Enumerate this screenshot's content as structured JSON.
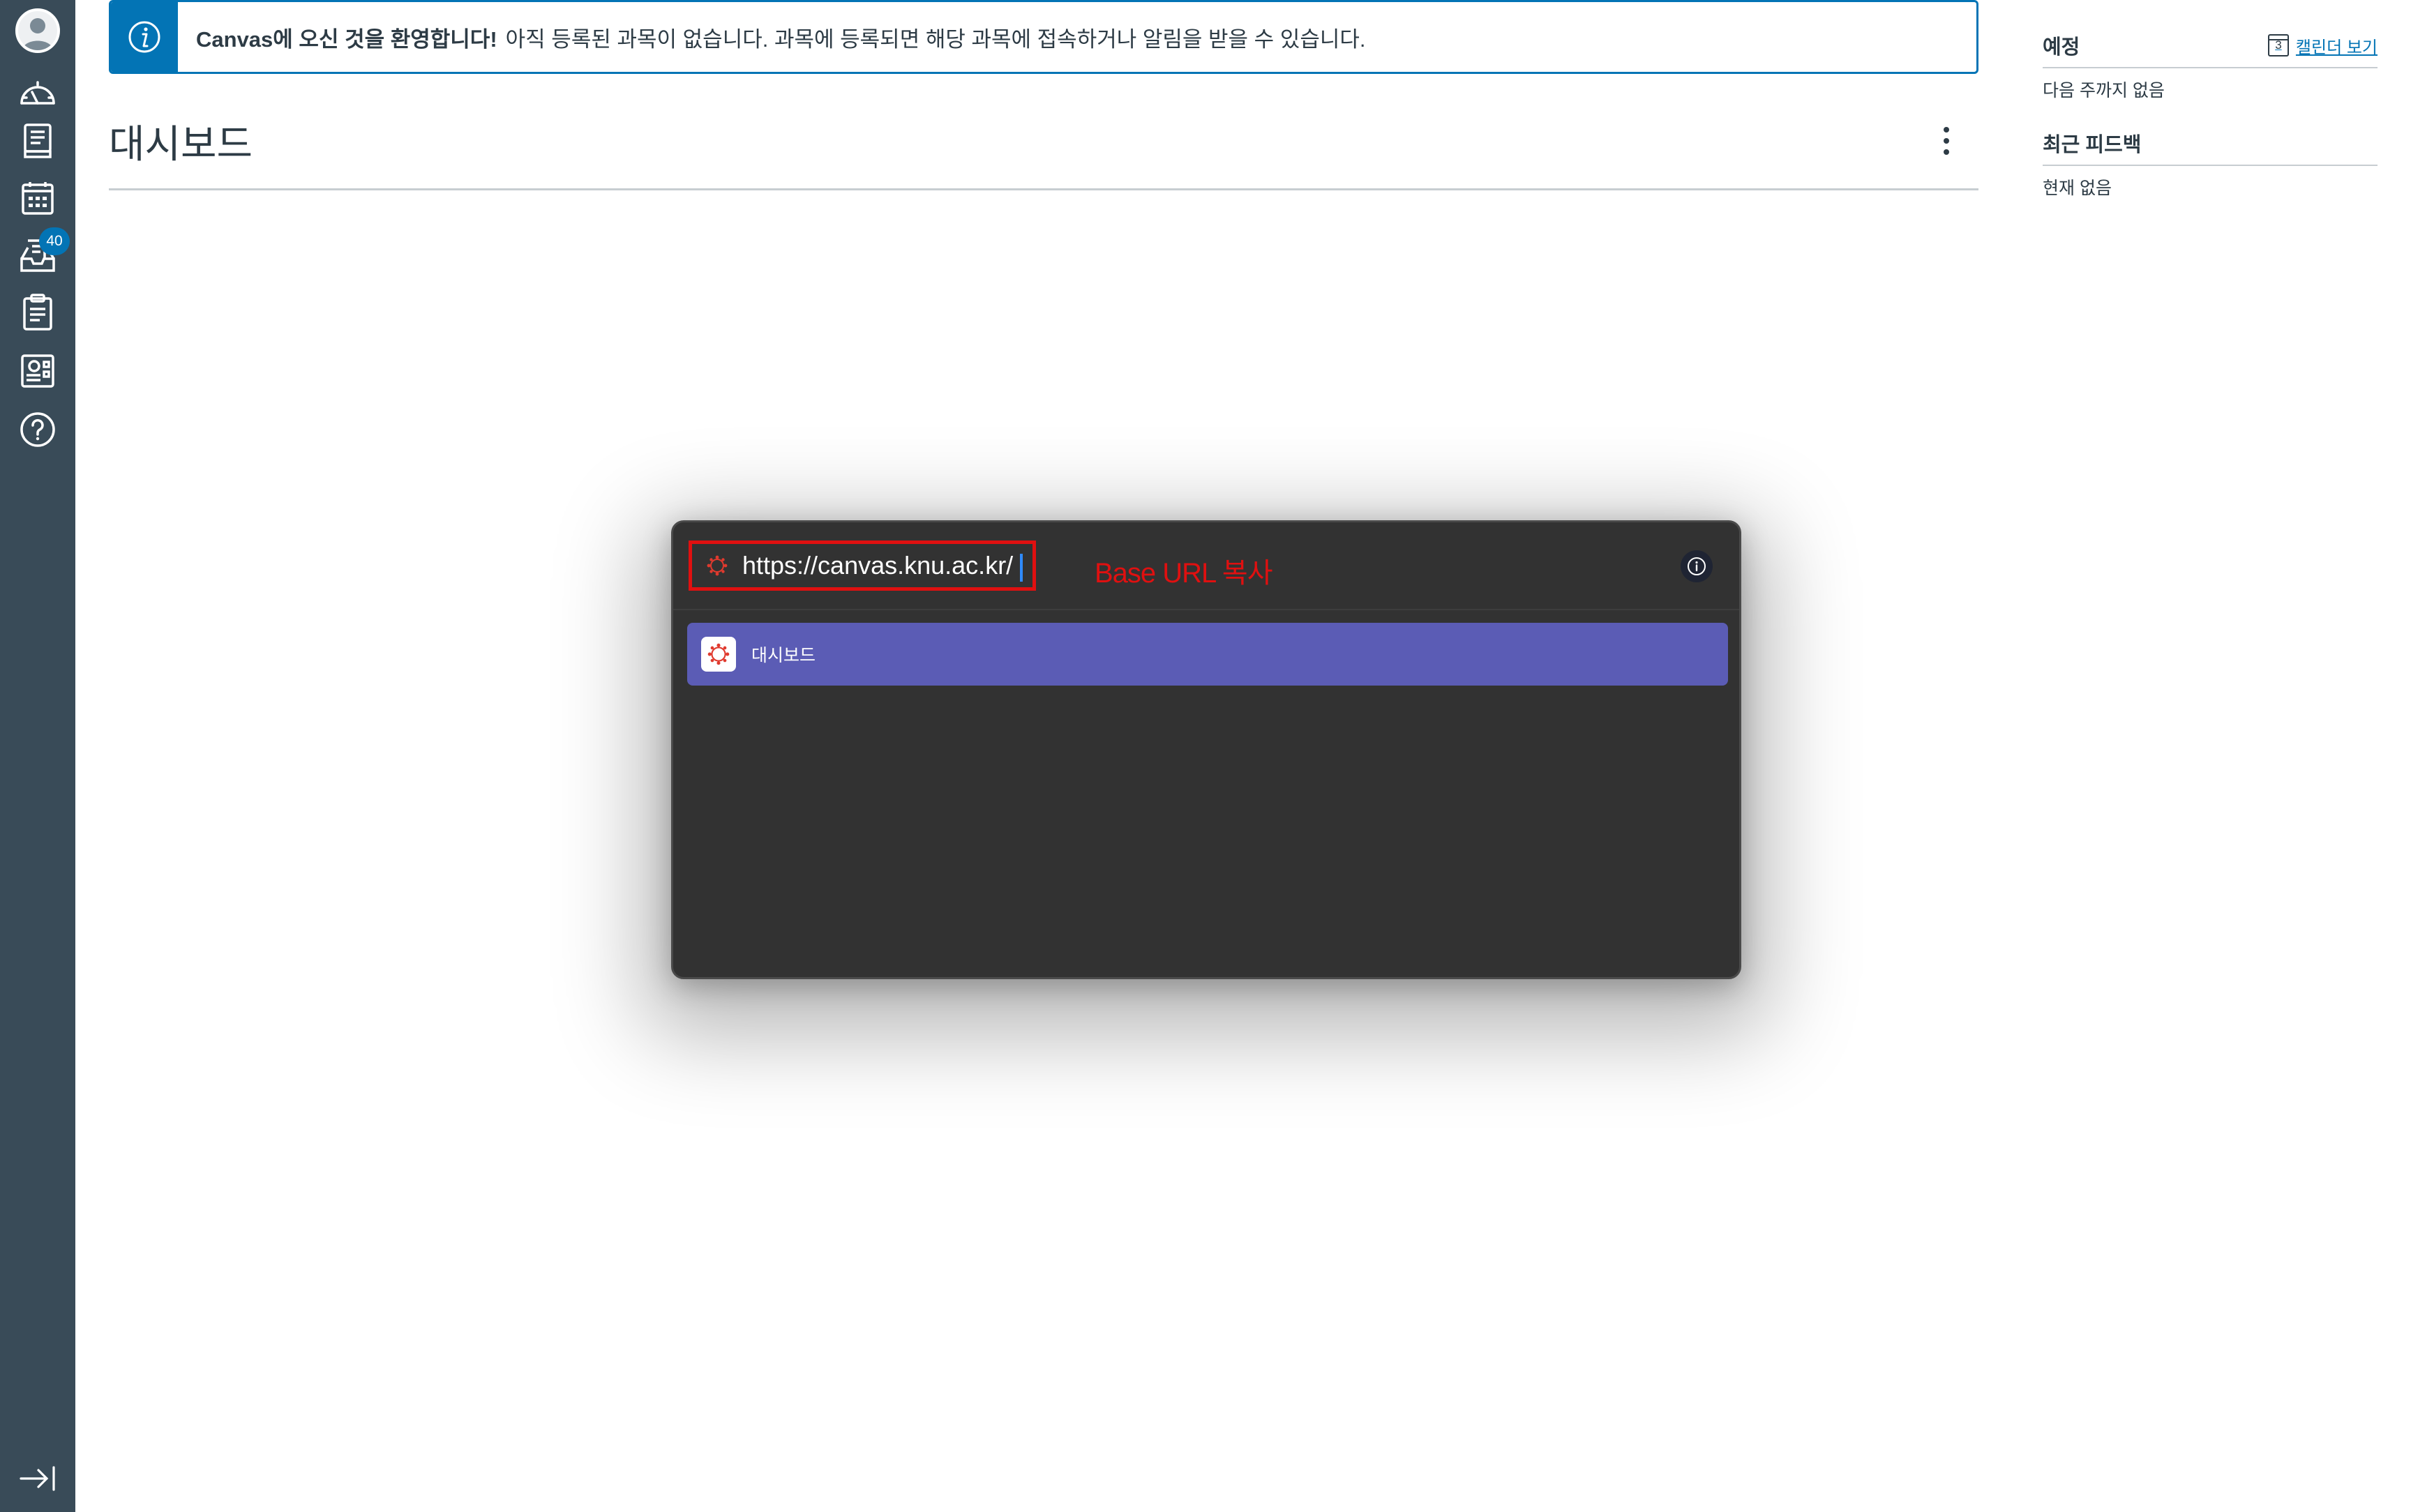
{
  "nav": {
    "items": [
      {
        "name": "account",
        "icon": "user-avatar-icon"
      },
      {
        "name": "dashboard",
        "icon": "dashboard-icon"
      },
      {
        "name": "courses",
        "icon": "courses-icon"
      },
      {
        "name": "calendar",
        "icon": "calendar-icon"
      },
      {
        "name": "inbox",
        "icon": "inbox-icon",
        "badge": "40"
      },
      {
        "name": "assignments",
        "icon": "clipboard-icon"
      },
      {
        "name": "portfolio",
        "icon": "portfolio-icon"
      },
      {
        "name": "help",
        "icon": "help-icon"
      },
      {
        "name": "collapse",
        "icon": "collapse-nav-icon"
      }
    ],
    "inbox_badge": "40"
  },
  "banner": {
    "bold": "Canvas에 오신 것을 환영합니다!",
    "text": "아직 등록된 과목이 없습니다. 과목에 등록되면 해당 과목에 접속하거나 알림을 받을 수 있습니다.",
    "icon": "info-icon",
    "accent": "#0374b5"
  },
  "page": {
    "title": "대시보드"
  },
  "sidebar": {
    "upcoming": {
      "heading": "예정",
      "calendar_link": "캘린더 보기",
      "calendar_day": "3",
      "empty": "다음 주까지 없음"
    },
    "feedback": {
      "heading": "최근 피드백",
      "empty": "현재 없음"
    }
  },
  "launcher": {
    "input_value": "https://canvas.knu.ac.kr/",
    "annotation": "Base URL 복사",
    "results": [
      {
        "label": "대시보드",
        "icon": "canvas-logo-icon"
      }
    ],
    "colors": {
      "background": "#323232",
      "highlight": "#5b5cb5",
      "annotation": "#e01010"
    }
  }
}
